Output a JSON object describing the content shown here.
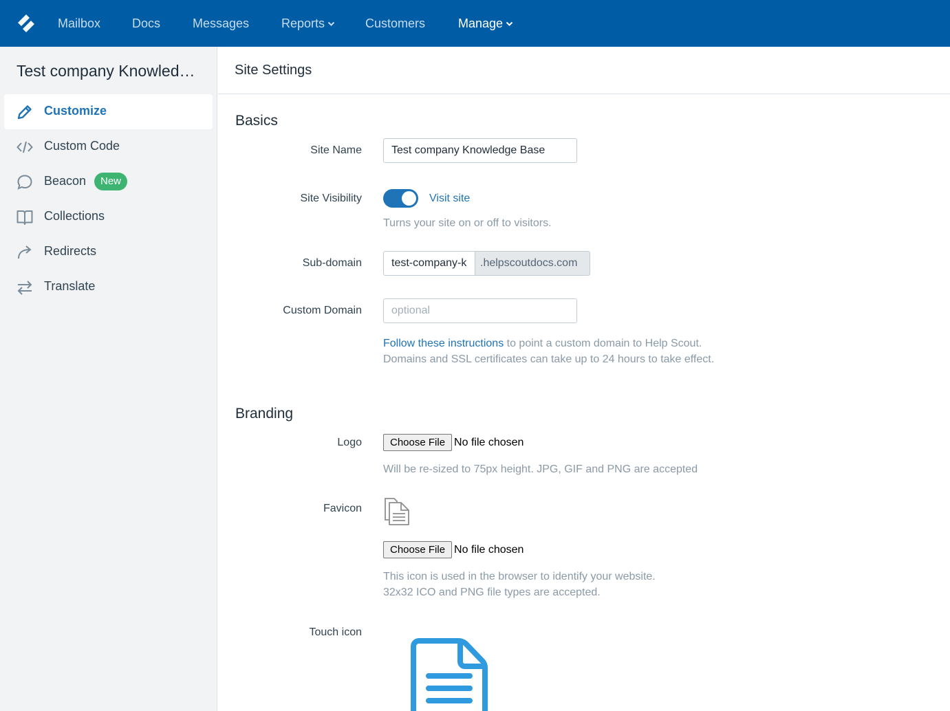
{
  "topnav": {
    "items": [
      {
        "label": "Mailbox"
      },
      {
        "label": "Docs"
      },
      {
        "label": "Messages"
      },
      {
        "label": "Reports"
      },
      {
        "label": "Customers"
      },
      {
        "label": "Manage"
      }
    ],
    "bg_color": "#005ca4"
  },
  "sidebar": {
    "title": "Test company Knowledge Base",
    "items": [
      {
        "label": "Customize",
        "icon": "pencil-icon",
        "active": true
      },
      {
        "label": "Custom Code",
        "icon": "code-icon"
      },
      {
        "label": "Beacon",
        "icon": "chat-bubble-icon",
        "badge": "New"
      },
      {
        "label": "Collections",
        "icon": "book-icon"
      },
      {
        "label": "Redirects",
        "icon": "redirect-arrow-icon"
      },
      {
        "label": "Translate",
        "icon": "swap-arrows-icon"
      }
    ]
  },
  "main": {
    "title": "Site Settings",
    "basics": {
      "heading": "Basics",
      "site_name": {
        "label": "Site Name",
        "value": "Test company Knowledge Base"
      },
      "site_visibility": {
        "label": "Site Visibility",
        "toggle_on": true,
        "link": "Visit site",
        "help": "Turns your site on or off to visitors."
      },
      "subdomain": {
        "label": "Sub-domain",
        "value": "test-company-k",
        "suffix": ".helpscoutdocs.com"
      },
      "custom_domain": {
        "label": "Custom Domain",
        "placeholder": "optional",
        "help_link": "Follow these instructions",
        "help_rest": " to point a custom domain to Help Scout.",
        "help_line2": "Domains and SSL certificates can take up to 24 hours to take effect."
      }
    },
    "branding": {
      "heading": "Branding",
      "logo": {
        "label": "Logo",
        "button": "Choose File",
        "status": "No file chosen",
        "help": "Will be re-sized to 75px height. JPG, GIF and PNG are accepted"
      },
      "favicon": {
        "label": "Favicon",
        "button": "Choose File",
        "status": "No file chosen",
        "help_line1": "This icon is used in the browser to identify your website.",
        "help_line2": "32x32 ICO and PNG file types are accepted."
      },
      "touch_icon": {
        "label": "Touch icon"
      }
    }
  },
  "colors": {
    "accent": "#1f73b7",
    "badge_green": "#3db472"
  }
}
